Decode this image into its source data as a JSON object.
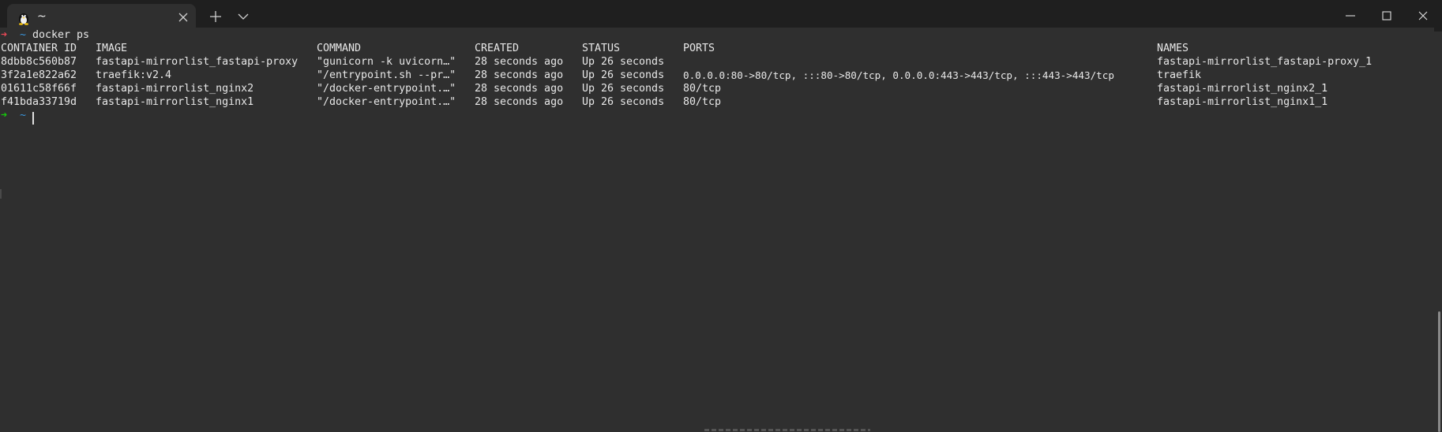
{
  "tab": {
    "icon": "linux-tux-icon",
    "title": "~"
  },
  "titlebar_buttons": {
    "new_tab": "plus-icon",
    "dropdown": "chevron-down-icon",
    "minimize": "minimize-icon",
    "maximize": "maximize-icon",
    "close": "close-icon"
  },
  "prompt": {
    "arrow": "➜",
    "dir": "~",
    "command": "docker ps"
  },
  "table": {
    "headers": [
      "CONTAINER ID",
      "IMAGE",
      "COMMAND",
      "CREATED",
      "STATUS",
      "PORTS",
      "NAMES"
    ],
    "rows": [
      [
        "8dbb8c560b87",
        "fastapi-mirrorlist_fastapi-proxy",
        "\"gunicorn -k uvicorn…\"",
        "28 seconds ago",
        "Up 26 seconds",
        "",
        "fastapi-mirrorlist_fastapi-proxy_1"
      ],
      [
        "3f2a1e822a62",
        "traefik:v2.4",
        "\"/entrypoint.sh --pr…\"",
        "28 seconds ago",
        "Up 26 seconds",
        "0.0.0.0:80->80/tcp, :::80->80/tcp, 0.0.0.0:443->443/tcp, :::443->443/tcp",
        "traefik"
      ],
      [
        "01611c58f66f",
        "fastapi-mirrorlist_nginx2",
        "\"/docker-entrypoint.…\"",
        "28 seconds ago",
        "Up 26 seconds",
        "80/tcp",
        "fastapi-mirrorlist_nginx2_1"
      ],
      [
        "f41bda33719d",
        "fastapi-mirrorlist_nginx1",
        "\"/docker-entrypoint.…\"",
        "28 seconds ago",
        "Up 26 seconds",
        "80/tcp",
        "fastapi-mirrorlist_nginx1_1"
      ]
    ]
  },
  "prompt2": {
    "arrow": "➜",
    "dir": "~"
  },
  "colors": {
    "background": "#2f2f2f",
    "titlebar": "#1f1f1f",
    "text": "#e8e8e8",
    "arrow_red": "#e74856",
    "arrow_green": "#16c60c",
    "tilde_blue": "#3a96dd"
  }
}
